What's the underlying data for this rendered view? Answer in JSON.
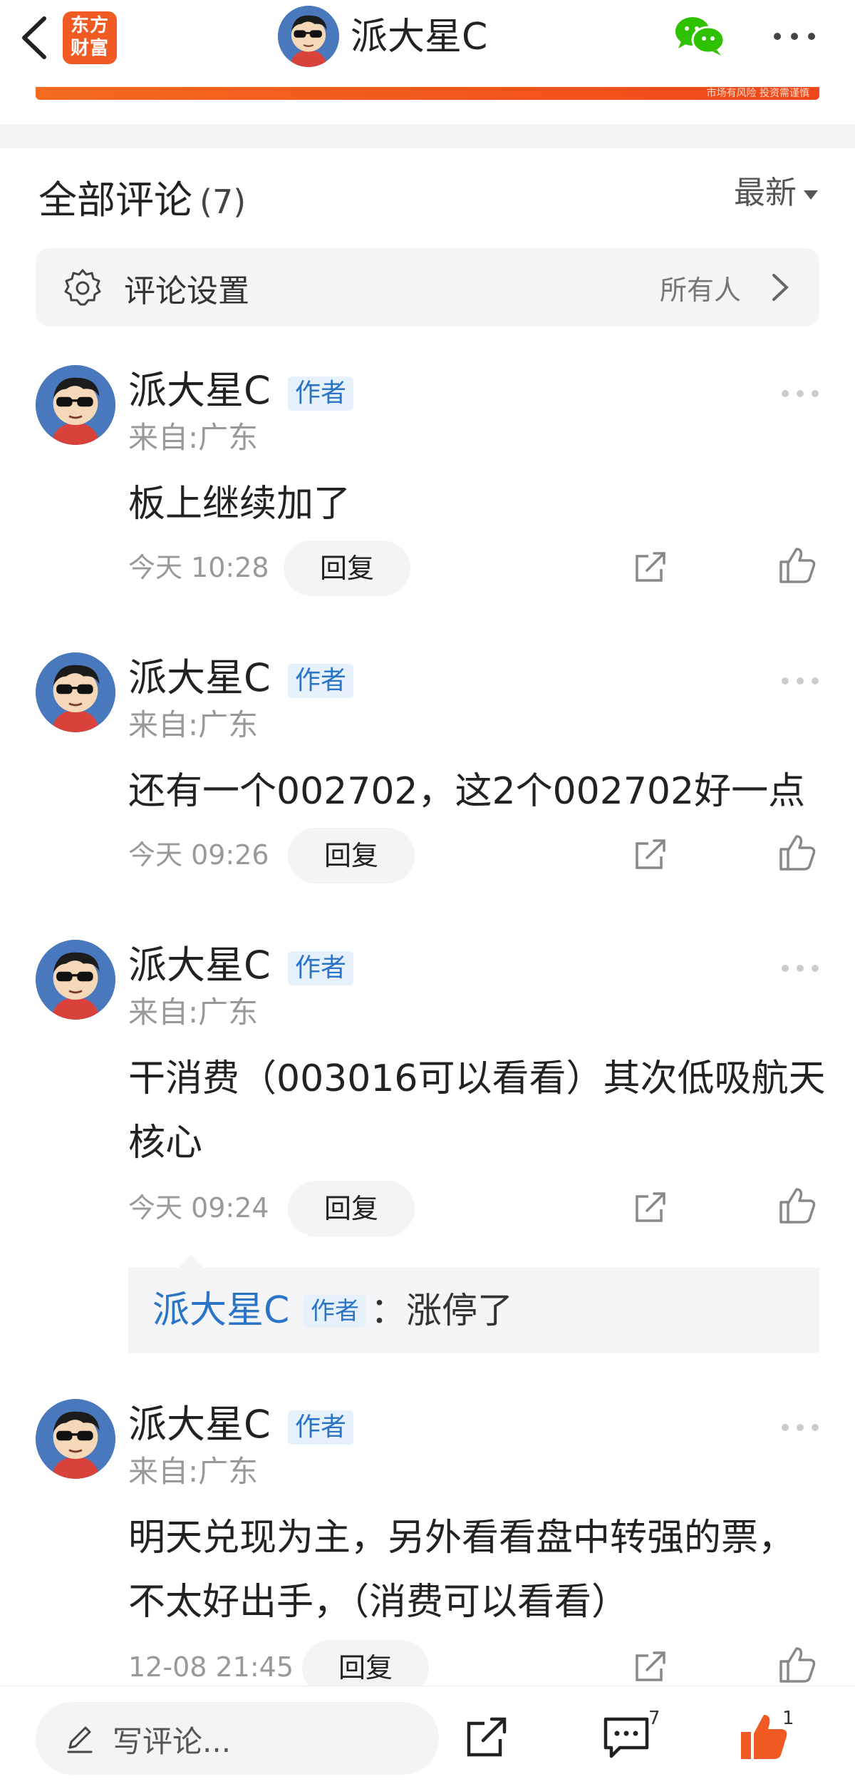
{
  "header": {
    "logo_line1": "东方",
    "logo_line2": "财富",
    "title": "派大星C",
    "banner_text": "市场有风险 投资需谨慎"
  },
  "comments_section": {
    "title": "全部评论",
    "count": "(7)",
    "sort_label": "最新",
    "settings_label": "评论设置",
    "settings_value": "所有人"
  },
  "comments": [
    {
      "name": "派大星C",
      "tag": "作者",
      "location": "来自:广东",
      "text": "板上继续加了",
      "time": "今天 10:28",
      "reply_label": "回复"
    },
    {
      "name": "派大星C",
      "tag": "作者",
      "location": "来自:广东",
      "text": "还有一个002702，这2个002702好一点",
      "time": "今天 09:26",
      "reply_label": "回复"
    },
    {
      "name": "派大星C",
      "tag": "作者",
      "location": "来自:广东",
      "text": "干消费（003016可以看看）其次低吸航天核心",
      "time": "今天 09:24",
      "reply_label": "回复",
      "reply": {
        "name": "派大星C",
        "tag": "作者",
        "text": "：涨停了"
      }
    },
    {
      "name": "派大星C",
      "tag": "作者",
      "location": "来自:广东",
      "text": "明天兑现为主，另外看看盘中转强的票，不太好出手，（消费可以看看）",
      "time": "12-08 21:45",
      "reply_label": "回复"
    }
  ],
  "bottom_bar": {
    "write_placeholder": "写评论...",
    "comment_count": "7",
    "like_count": "1"
  },
  "colors": {
    "brand": "#f15a22",
    "link": "#2b74c6",
    "like_active": "#f15a22"
  }
}
